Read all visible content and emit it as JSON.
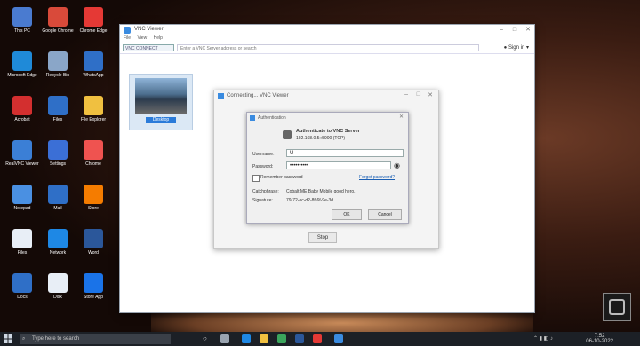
{
  "desktop": {
    "icons": [
      {
        "label": "This PC",
        "color": "#4a7bd0"
      },
      {
        "label": "Google Chrome",
        "color": "#d94a3a"
      },
      {
        "label": "Chrome Edge",
        "color": "#e53935"
      },
      {
        "label": "Microsoft Edge",
        "color": "#1f8ad8"
      },
      {
        "label": "Recycle Bin",
        "color": "#8aa6c8"
      },
      {
        "label": "WhatsApp",
        "color": "#2f6fc7"
      },
      {
        "label": "Acrobat",
        "color": "#d32f2f"
      },
      {
        "label": "Files",
        "color": "#2f6fc7"
      },
      {
        "label": "File Explorer",
        "color": "#f0c040"
      },
      {
        "label": "RealVNC Viewer",
        "color": "#3b7fd6"
      },
      {
        "label": "Settings",
        "color": "#3b6fd6"
      },
      {
        "label": "Chrome",
        "color": "#ef5350"
      },
      {
        "label": "Notepad",
        "color": "#4a90e2"
      },
      {
        "label": "Mail",
        "color": "#2f6fc7"
      },
      {
        "label": "Store",
        "color": "#f57c00"
      },
      {
        "label": "Files",
        "color": "#e8eef6"
      },
      {
        "label": "Network",
        "color": "#1e88e5"
      },
      {
        "label": "Word",
        "color": "#2b579a"
      },
      {
        "label": "Docs",
        "color": "#2f6fc7"
      },
      {
        "label": "Disk",
        "color": "#e8eef6"
      },
      {
        "label": "Store App",
        "color": "#1a73e8"
      }
    ]
  },
  "vnc": {
    "title": "VNC Viewer",
    "menu": [
      "File",
      "View",
      "Help"
    ],
    "address_tag": "VNC CONNECT",
    "address_placeholder": "Enter a VNC Server address or search",
    "sign_in": "Sign in",
    "thumb_label": "Desktop"
  },
  "connecting": {
    "title": "Connecting... VNC Viewer",
    "stop_label": "Stop"
  },
  "auth": {
    "title": "Authentication",
    "heading": "Authenticate to VNC Server",
    "server": "192.168.0.5::5900 (TCP)",
    "username_label": "Username:",
    "username_value": "U",
    "password_label": "Password:",
    "password_value": "••••••••••",
    "remember_label": "Remember password",
    "forgot_link": "Forgot password?",
    "catchphrase_label": "Catchphrase:",
    "catchphrase_value": "Cobalt ME Baby Mobile good hero.",
    "signature_label": "Signature:",
    "signature_value": "79-72-ec-d2-8f-6f-9e-3d",
    "ok_label": "OK",
    "cancel_label": "Cancel"
  },
  "taskbar": {
    "search_placeholder": "Type here to search",
    "time": "7:52",
    "date": "06-10-2022"
  }
}
